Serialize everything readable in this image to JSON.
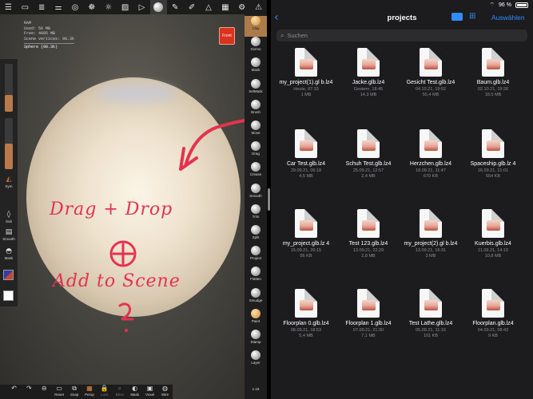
{
  "left": {
    "toolbar_icons": [
      "menu-icon",
      "folder-icon",
      "layers-icon",
      "sliders-icon",
      "globe-icon",
      "settings-icon",
      "sun-icon",
      "image-icon",
      "video-icon",
      "sphere-icon",
      "brush-icon",
      "pen-icon",
      "sculpt-icon",
      "grid-icon",
      "gear-icon",
      "warning-icon"
    ],
    "stats": {
      "ram": "RAM",
      "used": "Used: 56 MB",
      "free": "Free: 4605 MB",
      "scene_vertices": "Scene vertices: 98.3k",
      "sphere": "Sphere (98.3k)"
    },
    "front_label": "Front",
    "left_panel": {
      "sym_label": "Sym",
      "sub_label": "Sub",
      "smooth_label": "Smooth",
      "mask_label": "Mask",
      "slider1_fill": 0.35,
      "slider2_fill": 0.5,
      "accent_color": "#b9794a"
    },
    "tools": [
      {
        "label": "Clay",
        "active": true
      },
      {
        "label": "Gizmo"
      },
      {
        "label": "Mask"
      },
      {
        "label": "SelMask"
      },
      {
        "label": "Brush"
      },
      {
        "label": "Move"
      },
      {
        "label": "Drag"
      },
      {
        "label": "Crease"
      },
      {
        "label": "Smooth"
      },
      {
        "label": "Trim"
      },
      {
        "label": "Split"
      },
      {
        "label": "Project"
      },
      {
        "label": "Flatten"
      },
      {
        "label": "Smudge"
      },
      {
        "label": "Paint"
      },
      {
        "label": "Stamp"
      },
      {
        "label": "Layer"
      }
    ],
    "zoom": "1.18",
    "bottom": [
      {
        "label": "",
        "glyph": "↶"
      },
      {
        "label": "",
        "glyph": "↷"
      },
      {
        "label": "",
        "glyph": "⊖"
      },
      {
        "label": "Reset",
        "glyph": "▭"
      },
      {
        "label": "Snap",
        "glyph": "⧉"
      },
      {
        "label": "Persp",
        "glyph": "▦"
      },
      {
        "label": "Lock",
        "glyph": "🔒",
        "dim": true
      },
      {
        "label": "Bbox",
        "glyph": "⌕",
        "dim": true
      },
      {
        "label": "Mask",
        "glyph": "◐"
      },
      {
        "label": "Voxel",
        "glyph": "▣"
      },
      {
        "label": "Wire",
        "glyph": "◍"
      }
    ],
    "annotation": {
      "line1": "Drag + Drop",
      "line2": "Add to Scene",
      "color": "#e4334f"
    }
  },
  "right": {
    "status": {
      "battery": "96 %"
    },
    "title": "projects",
    "select_label": "Auswählen",
    "search_placeholder": "Suchen",
    "accent_color": "#2f8cff",
    "files": [
      {
        "name": "my_project(1).gl b.lz4",
        "date": "Heute, 07:33",
        "size": "1 MB"
      },
      {
        "name": "Jacke.glb.lz4",
        "date": "Gestern, 18:45",
        "size": "14,3 MB"
      },
      {
        "name": "Gesicht Test.glb.lz4",
        "date": "04.10.21, 19:52",
        "size": "55,4 MB"
      },
      {
        "name": "Baum.glb.lz4",
        "date": "02.10.21, 19:26",
        "size": "18,5 MB"
      },
      {
        "name": "Car Test.glb.lz4",
        "date": "29.09.21, 06:18",
        "size": "4,5 MB"
      },
      {
        "name": "Schuh Test.glb.lz4",
        "date": "25.09.21, 12:57",
        "size": "2,4 MB"
      },
      {
        "name": "Herzchen.glb.lz4",
        "date": "18.09.21, 11:47",
        "size": "670 KB"
      },
      {
        "name": "Spaceship.glb.lz 4",
        "date": "16.09.21, 21:01",
        "size": "554 KB"
      },
      {
        "name": "my_project.glb.lz 4",
        "date": "15.09.21, 20:15",
        "size": "56 KB"
      },
      {
        "name": "Test 123.glb.lz4",
        "date": "13.09.21, 22:29",
        "size": "2,8 MB"
      },
      {
        "name": "my_project(2).gl b.lz4",
        "date": "13.09.21, 16:31",
        "size": "3 MB"
      },
      {
        "name": "Kuerbis.glb.lz4",
        "date": "11.09.21, 14:10",
        "size": "10,8 MB"
      },
      {
        "name": "Floorplan 0.glb.lz4",
        "date": "08.09.21, 18:53",
        "size": "5,4 MB"
      },
      {
        "name": "Floorplan 1.glb.lz4",
        "date": "07.09.21, 21:30",
        "size": "7,1 MB"
      },
      {
        "name": "Test Lathe.glb.lz4",
        "date": "05.09.21, 11:16",
        "size": "101 KB"
      },
      {
        "name": "Floorplan.glb.lz4",
        "date": "04.09.21, 08:43",
        "size": "9 KB"
      }
    ]
  }
}
